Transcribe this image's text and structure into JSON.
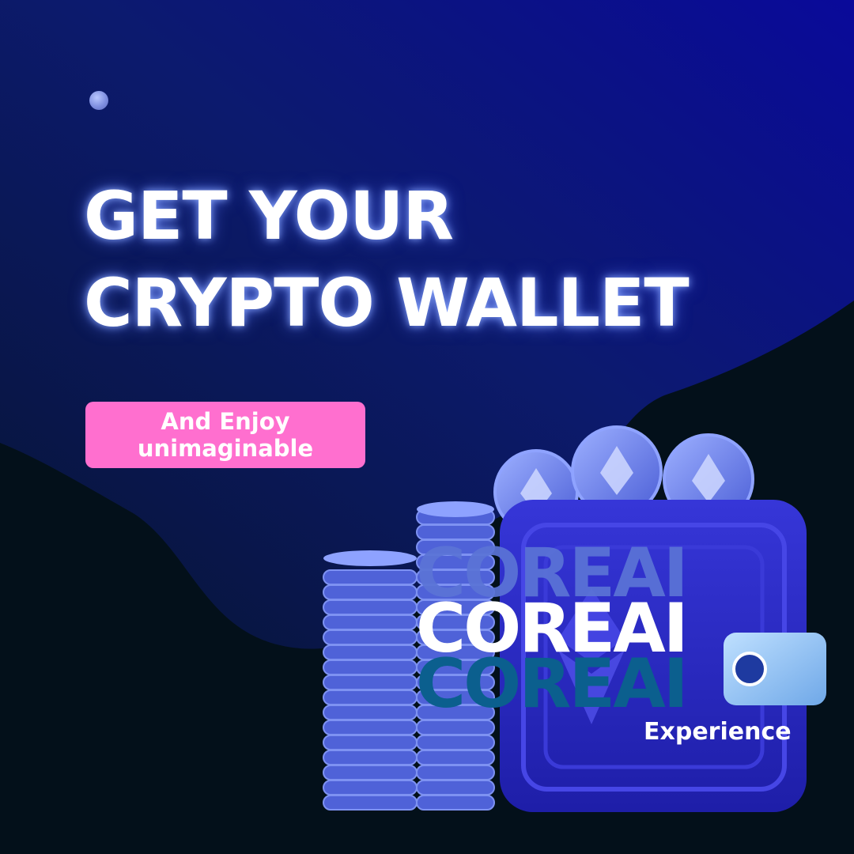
{
  "headline": {
    "line1": "GET YOUR",
    "line2": "CRYPTO WALLET"
  },
  "tagline": {
    "line1": "And  Enjoy",
    "line2": "unimaginable"
  },
  "brand_stack": [
    "COREAI",
    "COREAI",
    "COREAI"
  ],
  "experience_label": "Experience",
  "colors": {
    "background_dark": "#03101a",
    "background_blue": "#0a0a8c",
    "pill": "#ff6fcf",
    "coin": "#5b6ee0",
    "wallet": "#2727c9"
  },
  "icons": [
    "coin-stack-icon",
    "ethereum-coin-icon",
    "wallet-icon"
  ]
}
